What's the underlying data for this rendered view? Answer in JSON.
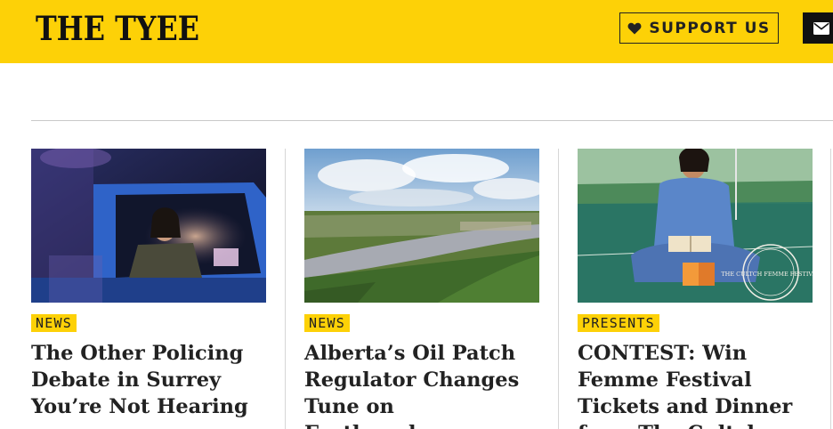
{
  "header": {
    "logo": "THE TYEE",
    "support_label": "SUPPORT US",
    "support_icon": "heart-icon",
    "newsletter_icon": "envelope-icon",
    "accent_color": "#fdd107"
  },
  "cards": [
    {
      "category": "NEWS",
      "headline": "The Other Policing Debate in Surrey You’re Not Hearing",
      "image": "police-officer-in-car-at-night-photo"
    },
    {
      "category": "NEWS",
      "headline": "Alberta’s Oil Patch Regulator Changes Tune on Earthquakes",
      "image": "river-valley-landscape-photo"
    },
    {
      "category": "PRESENTS",
      "headline": "CONTEST: Win Femme Festival Tickets and Dinner from The Cultch",
      "image": "woman-reading-on-court-photo",
      "seal_text": "THE CULTCH FEMME FESTIVAL"
    }
  ]
}
